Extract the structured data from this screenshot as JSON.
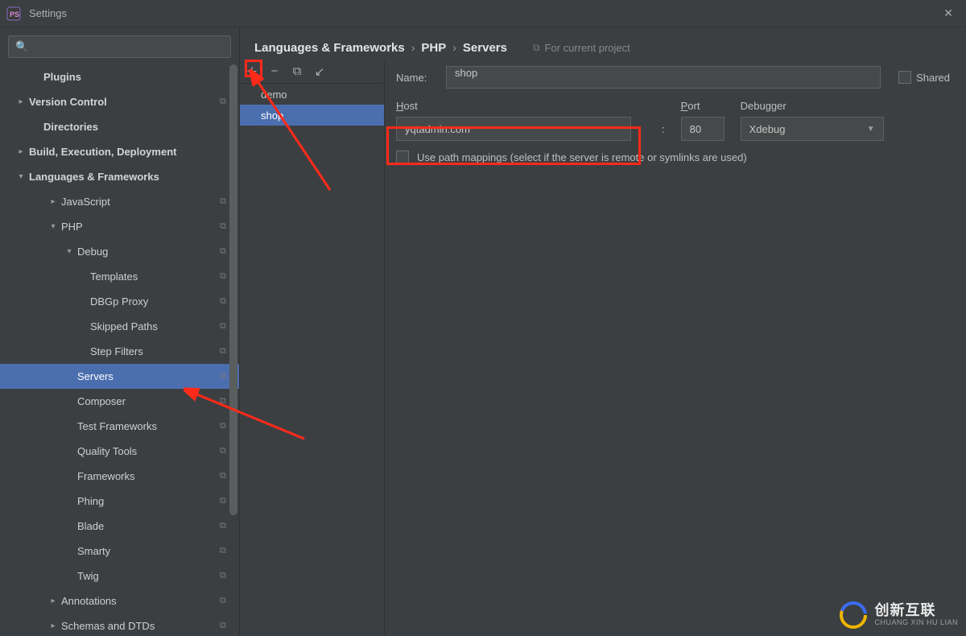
{
  "window": {
    "title": "Settings"
  },
  "sidebar": {
    "search_placeholder": "",
    "items": [
      {
        "label": "Plugins",
        "indent": "pad1",
        "arrow": "",
        "bold": true,
        "copy": false,
        "selected": false
      },
      {
        "label": "Version Control",
        "indent": "pad0",
        "arrow": "right",
        "bold": true,
        "copy": true,
        "selected": false
      },
      {
        "label": "Directories",
        "indent": "pad1",
        "arrow": "",
        "bold": true,
        "copy": false,
        "selected": false
      },
      {
        "label": "Build, Execution, Deployment",
        "indent": "pad0",
        "arrow": "right",
        "bold": true,
        "copy": false,
        "selected": false
      },
      {
        "label": "Languages & Frameworks",
        "indent": "pad0",
        "arrow": "down",
        "bold": true,
        "copy": false,
        "selected": false
      },
      {
        "label": "JavaScript",
        "indent": "pad2",
        "arrow": "right",
        "bold": false,
        "copy": true,
        "selected": false
      },
      {
        "label": "PHP",
        "indent": "pad2",
        "arrow": "down",
        "bold": false,
        "copy": true,
        "selected": false
      },
      {
        "label": "Debug",
        "indent": "pad3",
        "arrow": "down",
        "bold": false,
        "copy": true,
        "selected": false
      },
      {
        "label": "Templates",
        "indent": "pad4",
        "arrow": "",
        "bold": false,
        "copy": true,
        "selected": false
      },
      {
        "label": "DBGp Proxy",
        "indent": "pad4",
        "arrow": "",
        "bold": false,
        "copy": true,
        "selected": false
      },
      {
        "label": "Skipped Paths",
        "indent": "pad4",
        "arrow": "",
        "bold": false,
        "copy": true,
        "selected": false
      },
      {
        "label": "Step Filters",
        "indent": "pad4",
        "arrow": "",
        "bold": false,
        "copy": true,
        "selected": false
      },
      {
        "label": "Servers",
        "indent": "pad3",
        "arrow": "",
        "bold": false,
        "copy": true,
        "selected": true
      },
      {
        "label": "Composer",
        "indent": "pad3",
        "arrow": "",
        "bold": false,
        "copy": true,
        "selected": false
      },
      {
        "label": "Test Frameworks",
        "indent": "pad3",
        "arrow": "",
        "bold": false,
        "copy": true,
        "selected": false
      },
      {
        "label": "Quality Tools",
        "indent": "pad3",
        "arrow": "",
        "bold": false,
        "copy": true,
        "selected": false
      },
      {
        "label": "Frameworks",
        "indent": "pad3",
        "arrow": "",
        "bold": false,
        "copy": true,
        "selected": false
      },
      {
        "label": "Phing",
        "indent": "pad3",
        "arrow": "",
        "bold": false,
        "copy": true,
        "selected": false
      },
      {
        "label": "Blade",
        "indent": "pad3",
        "arrow": "",
        "bold": false,
        "copy": true,
        "selected": false
      },
      {
        "label": "Smarty",
        "indent": "pad3",
        "arrow": "",
        "bold": false,
        "copy": true,
        "selected": false
      },
      {
        "label": "Twig",
        "indent": "pad3",
        "arrow": "",
        "bold": false,
        "copy": true,
        "selected": false
      },
      {
        "label": "Annotations",
        "indent": "pad2",
        "arrow": "right",
        "bold": false,
        "copy": true,
        "selected": false
      },
      {
        "label": "Schemas and DTDs",
        "indent": "pad2",
        "arrow": "right",
        "bold": false,
        "copy": true,
        "selected": false
      }
    ]
  },
  "breadcrumb": {
    "parts": [
      "Languages & Frameworks",
      "PHP",
      "Servers"
    ],
    "hint": "For current project"
  },
  "servers": {
    "items": [
      {
        "label": "demo",
        "selected": false
      },
      {
        "label": "shop",
        "selected": true
      }
    ]
  },
  "form": {
    "name_label": "Name:",
    "name_value": "shop",
    "shared_label": "Shared",
    "host_label": "Host",
    "host_value": "yqtadmin.com",
    "port_label": "Port",
    "port_value": "80",
    "debugger_label": "Debugger",
    "debugger_value": "Xdebug",
    "mappings_label": "Use path mappings (select if the server is remote or symlinks are used)"
  },
  "watermark": {
    "big": "创新互联",
    "small": "CHUANG XIN HU LIAN"
  }
}
